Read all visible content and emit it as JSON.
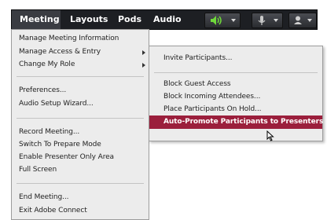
{
  "menubar": {
    "items": [
      "Meeting",
      "Layouts",
      "Pods",
      "Audio"
    ],
    "speaker_icon": "speaker-icon",
    "mic_icon": "microphone-icon",
    "camera_icon": "user-camera-icon"
  },
  "meeting_menu": {
    "items": [
      "Manage Meeting Information",
      "Manage Access & Entry",
      "Change My Role",
      "Preferences...",
      "Audio Setup Wizard...",
      "Record Meeting...",
      "Switch To Prepare Mode",
      "Enable Presenter Only Area",
      "Full Screen",
      "End Meeting...",
      "Exit Adobe Connect"
    ]
  },
  "access_submenu": {
    "items": [
      "Invite Participants...",
      "Block Guest Access",
      "Block Incoming Attendees...",
      "Place Participants On Hold...",
      "Auto-Promote Participants to Presenters"
    ]
  },
  "colors": {
    "menubar": "#1d1f23",
    "highlight": "#9b1f3c",
    "speaker_green": "#6fd83a"
  }
}
